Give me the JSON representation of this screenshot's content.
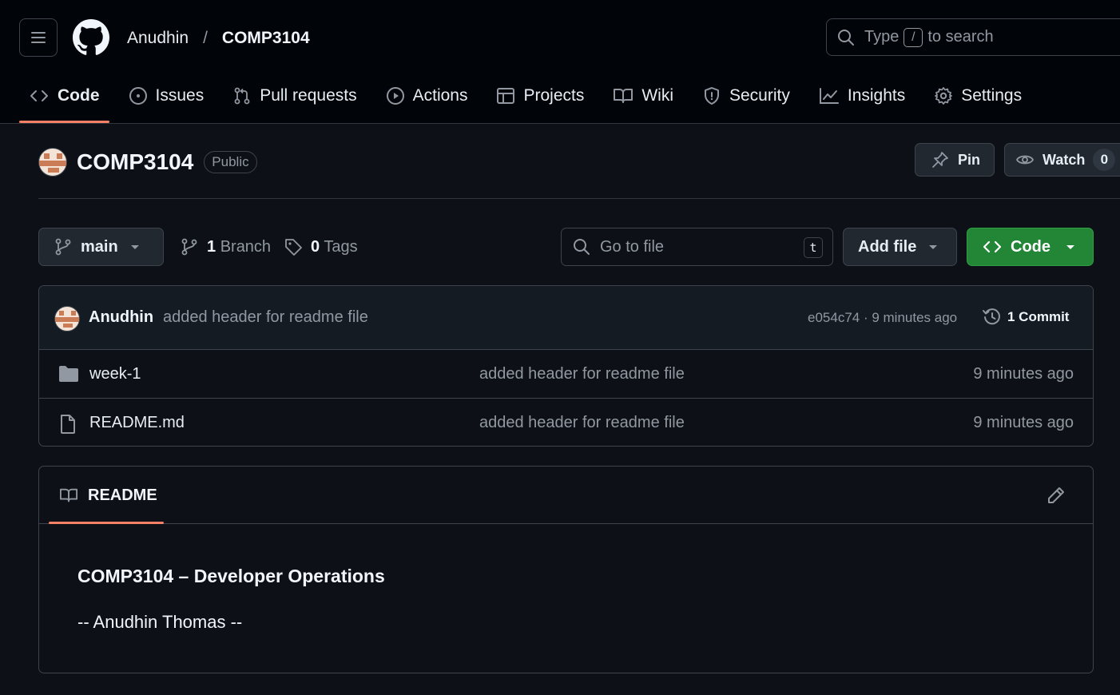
{
  "header": {
    "owner": "Anudhin",
    "separator": "/",
    "repo": "COMP3104",
    "search": {
      "prefix": "Type",
      "key": "/",
      "suffix": "to search"
    }
  },
  "tabs": [
    {
      "label": "Code",
      "icon": "code-icon",
      "active": true
    },
    {
      "label": "Issues",
      "icon": "issue-icon"
    },
    {
      "label": "Pull requests",
      "icon": "pull-request-icon"
    },
    {
      "label": "Actions",
      "icon": "play-icon"
    },
    {
      "label": "Projects",
      "icon": "table-icon"
    },
    {
      "label": "Wiki",
      "icon": "book-icon"
    },
    {
      "label": "Security",
      "icon": "shield-icon"
    },
    {
      "label": "Insights",
      "icon": "graph-icon"
    },
    {
      "label": "Settings",
      "icon": "gear-icon"
    }
  ],
  "repo": {
    "title": "COMP3104",
    "visibility": "Public",
    "pin_label": "Pin",
    "watch_label": "Watch",
    "watch_count": "0"
  },
  "toolbar": {
    "branch": "main",
    "branch_count": "1",
    "branch_label": "Branch",
    "tag_count": "0",
    "tag_label": "Tags",
    "goto_placeholder": "Go to file",
    "goto_key": "t",
    "add_file": "Add file",
    "code": "Code"
  },
  "latest_commit": {
    "author": "Anudhin",
    "message": "added header for readme file",
    "meta": "e054c74 · 9 minutes ago",
    "count_label": "1 Commit"
  },
  "files": [
    {
      "type": "folder",
      "name": "week-1",
      "commit": "added header for readme file",
      "age": "9 minutes ago"
    },
    {
      "type": "file",
      "name": "README.md",
      "commit": "added header for readme file",
      "age": "9 minutes ago"
    }
  ],
  "readme": {
    "tab_label": "README",
    "heading": "COMP3104 – Developer Operations",
    "paragraph": "-- Anudhin Thomas --"
  },
  "colors": {
    "accent_tab": "#f78166",
    "primary_button": "#238636",
    "background": "#0d1117",
    "header_background": "#010409"
  }
}
